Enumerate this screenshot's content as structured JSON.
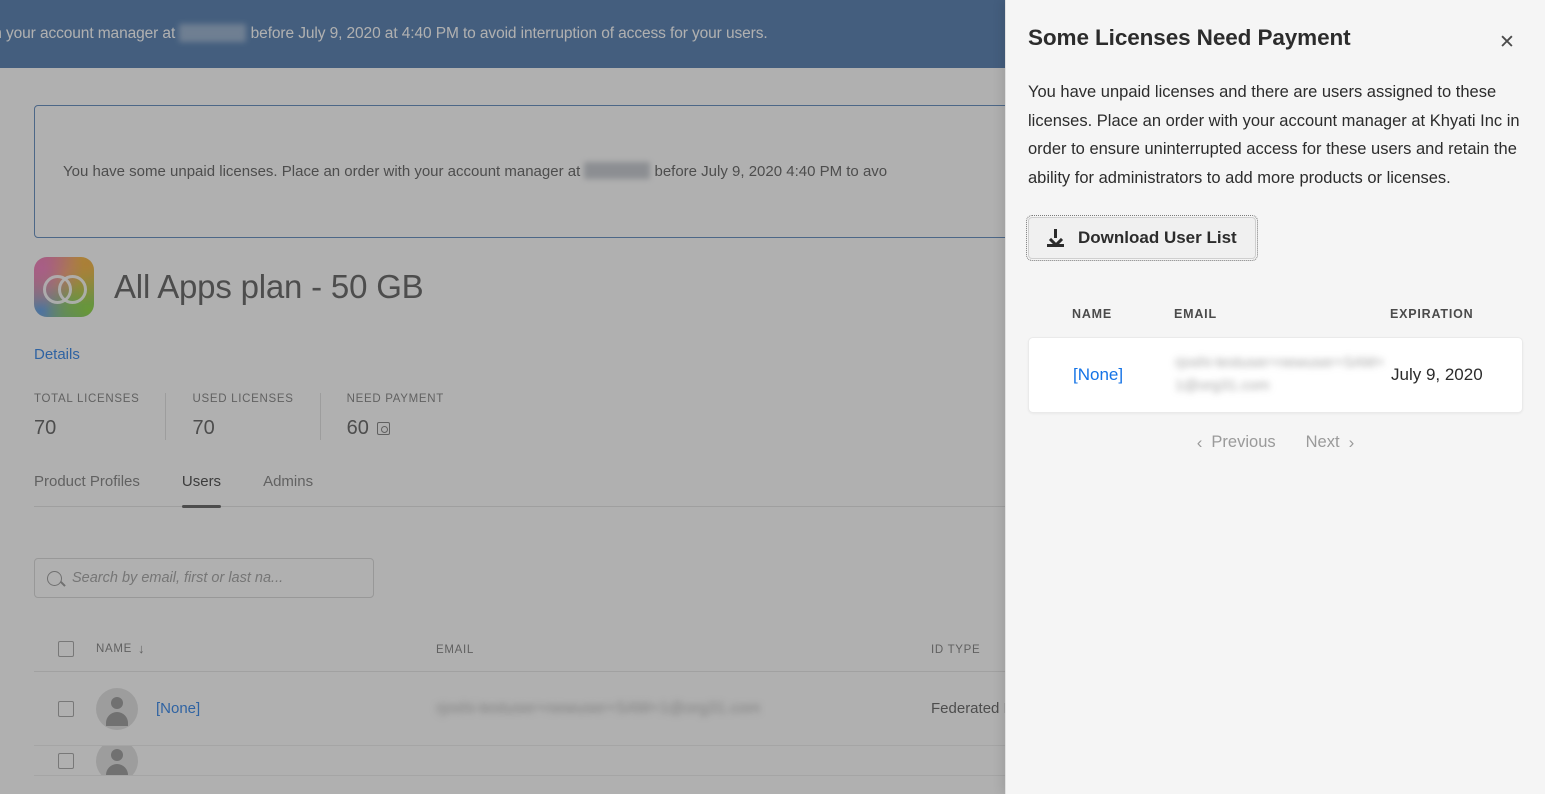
{
  "background": {
    "top_banner": {
      "text_before": "n order with your account manager at",
      "redacted_company": "Khyati Inc",
      "text_after": "before July 9, 2020 at 4:40 PM to avoid interruption of access for your users."
    },
    "alert": {
      "text_before": "You have some unpaid licenses. Place an order with your account manager at",
      "redacted_company": "Khyati Inc",
      "text_after": "before July 9, 2020 4:40 PM to avo"
    },
    "plan": {
      "title": "All Apps plan - 50 GB",
      "icon": "creative-cloud-icon"
    },
    "details_link": "Details",
    "stats": [
      {
        "label": "TOTAL LICENSES",
        "value": "70",
        "has_icon": false
      },
      {
        "label": "USED LICENSES",
        "value": "70",
        "has_icon": false
      },
      {
        "label": "NEED PAYMENT",
        "value": "60",
        "has_icon": true
      }
    ],
    "tabs": [
      {
        "label": "Product Profiles",
        "active": false
      },
      {
        "label": "Users",
        "active": true
      },
      {
        "label": "Admins",
        "active": false
      }
    ],
    "search": {
      "placeholder": "Search by email, first or last na...",
      "value": "",
      "icon": "search-icon"
    },
    "users_table": {
      "columns": [
        "NAME",
        "EMAIL",
        "ID TYPE"
      ],
      "sort_column": "NAME",
      "sort_direction": "down-arrow",
      "rows": [
        {
          "name": "[None]",
          "email": "rjoshi-testuser+newuser+SAM+1@org31.com",
          "id_type": "Federated ID"
        }
      ]
    }
  },
  "panel": {
    "title": "Some Licenses Need Payment",
    "close_icon": "close-icon",
    "description": "You have unpaid licenses and there are users assigned to these licenses. Place an order with your account manager at Khyati Inc in order to ensure uninterrupted access for these users and retain the ability for administrators to add more products or licenses.",
    "download_button": {
      "label": "Download User List",
      "icon": "download-icon"
    },
    "table": {
      "columns": [
        "NAME",
        "EMAIL",
        "EXPIRATION"
      ],
      "rows": [
        {
          "name": "[None]",
          "email": "rjoshi-testuser+newuser+SAM+1@org31.com",
          "expiration": "July 9, 2020"
        }
      ]
    },
    "pagination": {
      "previous_label": "Previous",
      "next_label": "Next",
      "prev_icon": "chevron-left-icon",
      "next_icon": "chevron-right-icon"
    }
  },
  "colors": {
    "banner_blue": "#3b6ba5",
    "link_blue": "#1473e6",
    "panel_bg": "#f5f5f5",
    "text_dark": "#2c2c2c"
  }
}
